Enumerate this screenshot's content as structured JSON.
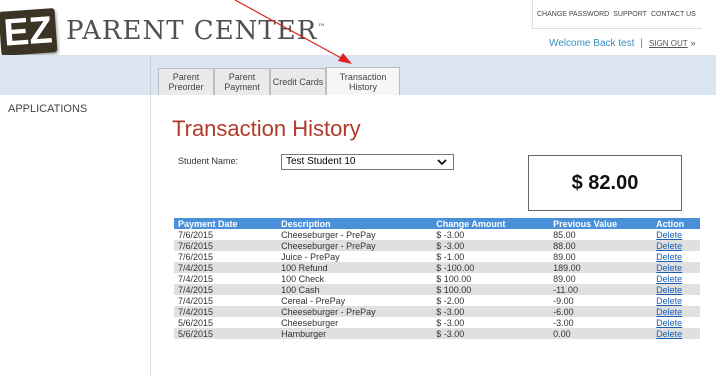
{
  "header": {
    "logo_mark": "EZ",
    "logo_text": "PARENT CENTER",
    "trademark": "™",
    "top_links": [
      "CHANGE PASSWORD",
      "SUPPORT",
      "CONTACT US"
    ],
    "welcome": "Welcome Back test",
    "separator": "|",
    "sign_out": "SIGN OUT",
    "sign_out_icon": "»"
  },
  "tabs": [
    {
      "label": "Parent Preorder",
      "active": false
    },
    {
      "label": "Parent Payment",
      "active": false
    },
    {
      "label": "Credit Cards",
      "active": false
    },
    {
      "label": "Transaction History",
      "active": true
    }
  ],
  "sidebar": {
    "applications": "APPLICATIONS"
  },
  "main": {
    "title": "Transaction History",
    "student_label": "Student Name:",
    "student_value": "Test Student 10",
    "balance": "$ 82.00"
  },
  "table": {
    "headers": [
      "Payment Date",
      "Description",
      "Change Amount",
      "Previous Value",
      "Action"
    ],
    "rows": [
      {
        "date": "7/6/2015",
        "description": "Cheeseburger - PrePay",
        "change": "$ -3.00",
        "previous": "85.00",
        "action": "Delete"
      },
      {
        "date": "7/6/2015",
        "description": "Cheeseburger - PrePay",
        "change": "$ -3.00",
        "previous": "88.00",
        "action": "Delete"
      },
      {
        "date": "7/6/2015",
        "description": "Juice - PrePay",
        "change": "$ -1.00",
        "previous": "89.00",
        "action": "Delete"
      },
      {
        "date": "7/4/2015",
        "description": "100 Refund",
        "change": "$ -100.00",
        "previous": "189.00",
        "action": "Delete"
      },
      {
        "date": "7/4/2015",
        "description": "100 Check",
        "change": "$ 100.00",
        "previous": "89.00",
        "action": "Delete"
      },
      {
        "date": "7/4/2015",
        "description": "100 Cash",
        "change": "$ 100.00",
        "previous": "-11.00",
        "action": "Delete"
      },
      {
        "date": "7/4/2015",
        "description": "Cereal - PrePay",
        "change": "$ -2.00",
        "previous": "-9.00",
        "action": "Delete"
      },
      {
        "date": "7/4/2015",
        "description": "Cheeseburger - PrePay",
        "change": "$ -3.00",
        "previous": "-6.00",
        "action": "Delete"
      },
      {
        "date": "5/6/2015",
        "description": "Cheeseburger",
        "change": "$ -3.00",
        "previous": "-3.00",
        "action": "Delete"
      },
      {
        "date": "5/6/2015",
        "description": "Hamburger",
        "change": "$ -3.00",
        "previous": "0.00",
        "action": "Delete"
      }
    ]
  },
  "colors": {
    "title": "#b23a2a",
    "table_header": "#4a90d9",
    "nav_bar": "#dbe5f1",
    "link": "#1a5fb4",
    "annotation_arrow": "#e02020"
  },
  "annotation": {
    "arrow_icon": "red-annotation-arrow"
  }
}
